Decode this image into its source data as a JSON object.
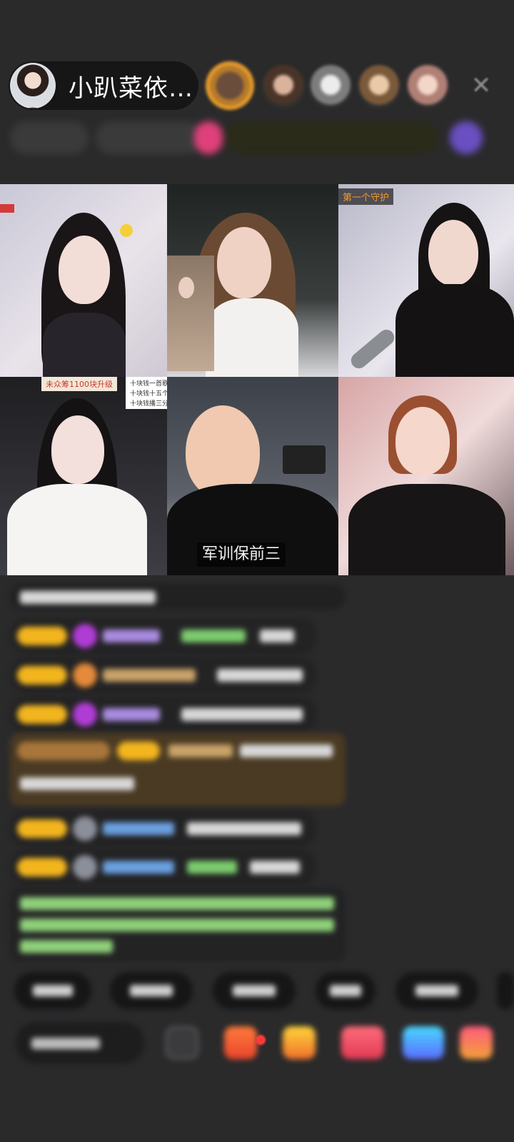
{
  "header": {
    "host_name": "小趴菜依…",
    "close_icon": "close-icon"
  },
  "grid": {
    "tiles": [
      {
        "label": ""
      },
      {
        "label": ""
      },
      {
        "label": "第一个守护"
      },
      {
        "label": ""
      },
      {
        "label": ""
      },
      {
        "label": ""
      }
    ],
    "tile4_tags": [
      "未众筹1100块升级",
      "十块钱一首歌",
      "十块钱十五个",
      "十块钱播三分"
    ],
    "caption": "军训保前三"
  },
  "colors": {
    "background": "#2a2a2b",
    "badge": "#f3b51e",
    "gift_bg": "#4a3a23",
    "system_text": "#8fd07a",
    "accent_orange": "#f39a2c"
  }
}
